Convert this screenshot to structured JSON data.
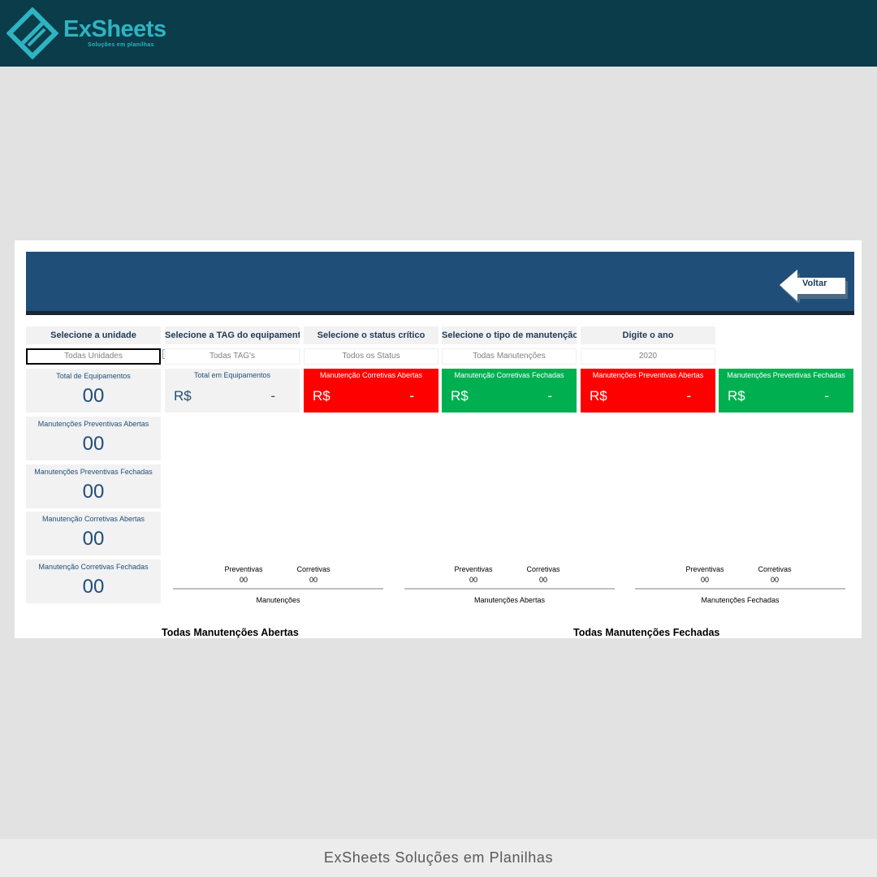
{
  "brand": {
    "name": "ExSheets",
    "tagline": "Soluções em planilhas",
    "color": "#2fb3c2"
  },
  "header": {
    "back_button_label": "Voltar",
    "color": "#1f4e79"
  },
  "filters": [
    {
      "label": "Selecione a unidade",
      "value": "Todas Unidades"
    },
    {
      "label": "Selecione a TAG do equipamento",
      "value": "Todas TAG's"
    },
    {
      "label": "Selecione o status crítico",
      "value": "Todos os Status"
    },
    {
      "label": "Selecione o tipo de manutenção",
      "value": "Todas Manutenções"
    },
    {
      "label": "Digite o ano",
      "value": "2020"
    }
  ],
  "count_cards": [
    {
      "title": "Total de Equipamentos",
      "value": "00"
    },
    {
      "title": "Manutenções Preventivas Abertas",
      "value": "00"
    },
    {
      "title": "Manutenções Preventivas Fechadas",
      "value": "00"
    },
    {
      "title": "Manutenção Corretivas Abertas",
      "value": "00"
    },
    {
      "title": "Manutenção Corretivas Fechadas",
      "value": "00"
    }
  ],
  "money_cards": [
    {
      "title": "Total em Equipamentos",
      "currency": "R$",
      "value": "-",
      "color": "#f2f2f2"
    },
    {
      "title": "Manutenção Corretivas Abertas",
      "currency": "R$",
      "value": "-",
      "color": "#ff0000"
    },
    {
      "title": "Manutenção Corretivas Fechadas",
      "currency": "R$",
      "value": "-",
      "color": "#00b050"
    },
    {
      "title": "Manutenções Preventivas Abertas",
      "currency": "R$",
      "value": "-",
      "color": "#ff0000"
    },
    {
      "title": "Manutenções Preventivas Fechadas",
      "currency": "R$",
      "value": "-",
      "color": "#00b050"
    }
  ],
  "summaries": [
    {
      "caption": "Manutenções",
      "preventivas_label": "Preventivas",
      "preventivas_value": "00",
      "corretivas_label": "Corretivas",
      "corretivas_value": "00"
    },
    {
      "caption": "Manutenções Abertas",
      "preventivas_label": "Preventivas",
      "preventivas_value": "00",
      "corretivas_label": "Corretivas",
      "corretivas_value": "00"
    },
    {
      "caption": "Manutenções Fechadas",
      "preventivas_label": "Preventivas",
      "preventivas_value": "00",
      "corretivas_label": "Corretivas",
      "corretivas_value": "00"
    }
  ],
  "sections": {
    "open_title": "Todas Manutenções Abertas",
    "closed_title": "Todas Manutenções Fechadas"
  },
  "footer": {
    "text": "ExSheets Soluções em Planilhas"
  }
}
